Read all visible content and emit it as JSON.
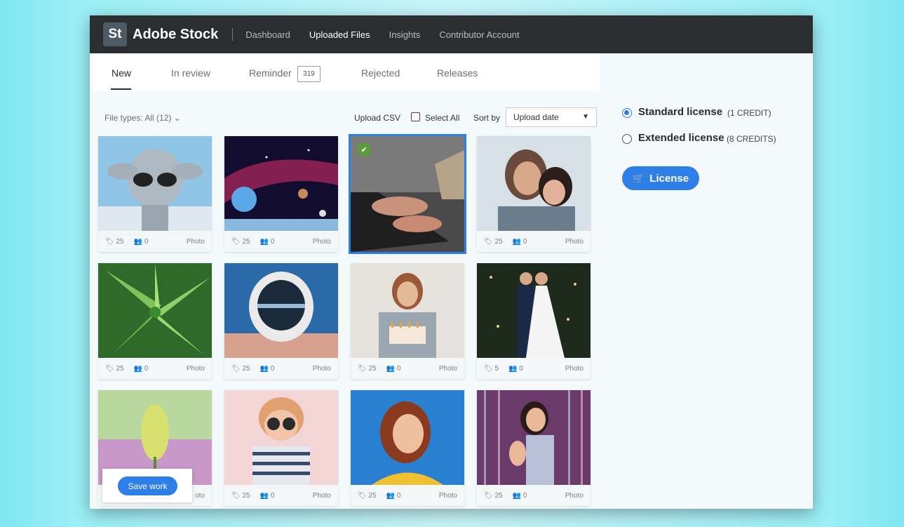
{
  "header": {
    "logo": "St",
    "brand": "Adobe Stock",
    "nav": [
      "Dashboard",
      "Uploaded Files",
      "Insights",
      "Contributor Account"
    ],
    "active_nav": "Uploaded Files"
  },
  "tabs": {
    "new": "New",
    "in_review": "In review",
    "reminder": "Reminder",
    "reminder_count": "319",
    "rejected": "Rejected",
    "releases": "Releases"
  },
  "toolbar": {
    "file_types": "File types: All (12)",
    "upload_csv": "Upload CSV",
    "select_all": "Select All",
    "sort_by": "Sort by",
    "sort_value": "Upload date"
  },
  "cards": [
    {
      "icon": "alien-photo",
      "keywords": "25",
      "people": "0",
      "type": "Photo"
    },
    {
      "icon": "galaxy-photo",
      "keywords": "25",
      "people": "0",
      "type": "Photo"
    },
    {
      "icon": "laptop-typing-photo",
      "keywords": "",
      "people": "",
      "type": ""
    },
    {
      "icon": "laughing-women-photo",
      "keywords": "25",
      "people": "0",
      "type": "Photo"
    },
    {
      "icon": "green-leaves-photo",
      "keywords": "25",
      "people": "0",
      "type": "Photo"
    },
    {
      "icon": "astronaut-photo",
      "keywords": "25",
      "people": "0",
      "type": "Photo"
    },
    {
      "icon": "birthday-cake-photo",
      "keywords": "25",
      "people": "0",
      "type": "Photo"
    },
    {
      "icon": "wedding-couple-photo",
      "keywords": "5",
      "people": "0",
      "type": "Photo"
    },
    {
      "icon": "tulip-photo",
      "keywords": "",
      "people": "",
      "type": "oto"
    },
    {
      "icon": "child-sunglasses-photo",
      "keywords": "25",
      "people": "0",
      "type": "Photo"
    },
    {
      "icon": "woman-portrait-photo",
      "keywords": "25",
      "people": "0",
      "type": "Photo"
    },
    {
      "icon": "dancing-woman-photo",
      "keywords": "25",
      "people": "0",
      "type": "Photo"
    }
  ],
  "save": {
    "label": "Save work"
  },
  "license": {
    "standard_label": "Standard license",
    "standard_credits": "(1 CREDIT)",
    "extended_label": "Extended license",
    "extended_credits": "(8 CREDITS)",
    "button": "License"
  },
  "colors": {
    "accent": "#2d7ee6",
    "topbar": "#2b2e31",
    "check": "#5c9b3b"
  }
}
